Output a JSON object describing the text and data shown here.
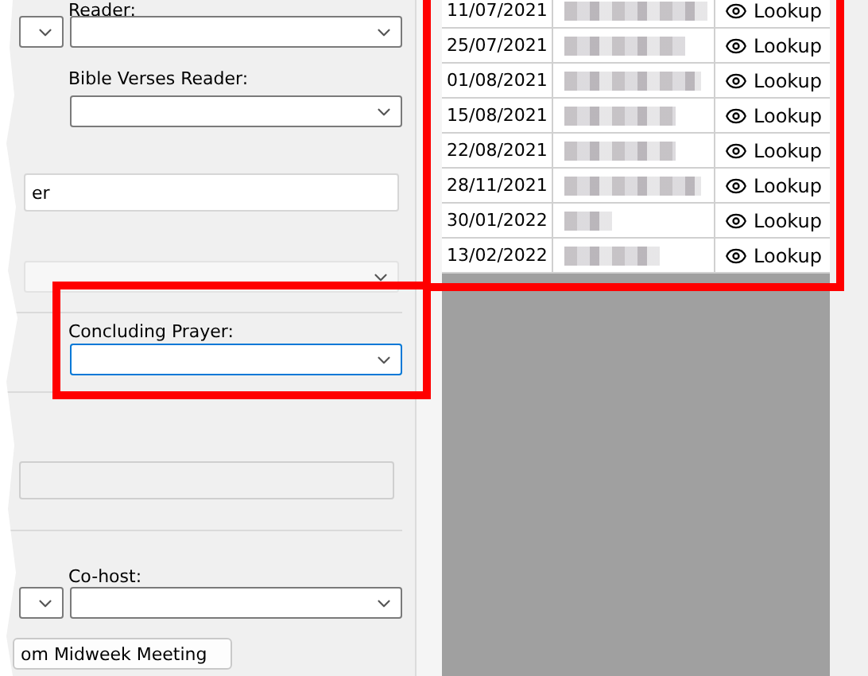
{
  "left_panel": {
    "reader": {
      "label": "Reader:"
    },
    "bible_verses_reader": {
      "label": "Bible Verses Reader:"
    },
    "text_field": {
      "value": "er"
    },
    "concluding_prayer": {
      "label": "Concluding Prayer:",
      "focused": true
    },
    "cohost": {
      "label": "Co-host:"
    },
    "button": {
      "label": "om Midweek Meeting"
    }
  },
  "history_table": {
    "rows": [
      {
        "date": "11/07/2021",
        "action": "Lookup"
      },
      {
        "date": "25/07/2021",
        "action": "Lookup"
      },
      {
        "date": "01/08/2021",
        "action": "Lookup"
      },
      {
        "date": "15/08/2021",
        "action": "Lookup"
      },
      {
        "date": "22/08/2021",
        "action": "Lookup"
      },
      {
        "date": "28/11/2021",
        "action": "Lookup"
      },
      {
        "date": "30/01/2022",
        "action": "Lookup"
      },
      {
        "date": "13/02/2022",
        "action": "Lookup"
      }
    ]
  }
}
